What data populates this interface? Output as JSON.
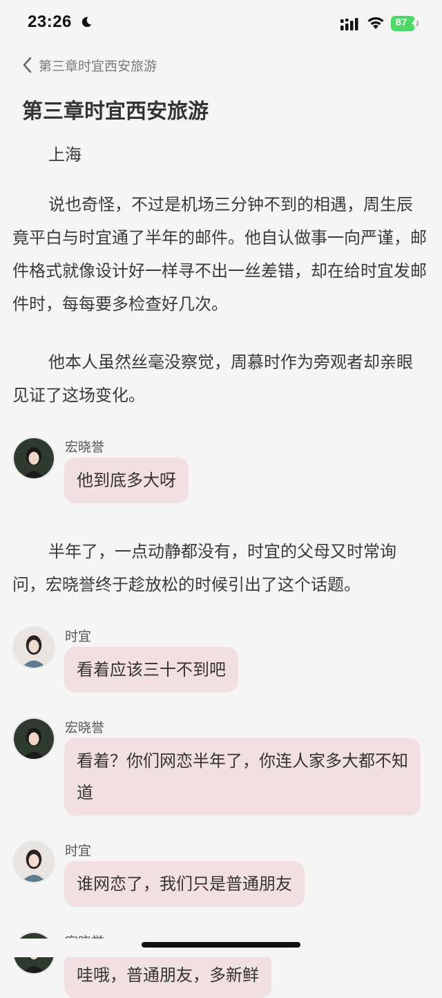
{
  "status_bar": {
    "time": "23:26",
    "battery_percent": "87",
    "icons": [
      "moon-icon",
      "signal-icon",
      "wifi-icon",
      "battery-icon"
    ]
  },
  "nav": {
    "back_label": "第三章时宜西安旅游"
  },
  "chapter": {
    "title": "第三章时宜西安旅游"
  },
  "content": {
    "location": "上海",
    "para1": "说也奇怪，不过是机场三分钟不到的相遇，周生辰竟平白与时宜通了半年的邮件。他自认做事一向严谨，邮件格式就像设计好一样寻不出一丝差错，却在给时宜发邮件时，每每要多检查好几次。",
    "para2": "他本人虽然丝毫没察觉，周慕时作为旁观者却亲眼见证了这场变化。",
    "msg1": {
      "speaker": "宏晓誉",
      "text": "他到底多大呀"
    },
    "para3": "半年了，一点动静都没有，时宜的父母又时常询问，宏晓誉终于趁放松的时候引出了这个话题。",
    "msg2": {
      "speaker": "时宜",
      "text": "看着应该三十不到吧"
    },
    "msg3": {
      "speaker": "宏晓誉",
      "text": "看着？你们网恋半年了，你连人家多大都不知道"
    },
    "msg4": {
      "speaker": "时宜",
      "text": "谁网恋了，我们只是普通朋友"
    },
    "msg5": {
      "speaker": "宏晓誉",
      "text": "哇哦，普通朋友，多新鲜"
    }
  },
  "colors": {
    "background": "#f5f5f5",
    "bubble": "#f1dfe1",
    "battery": "#4cd964"
  }
}
